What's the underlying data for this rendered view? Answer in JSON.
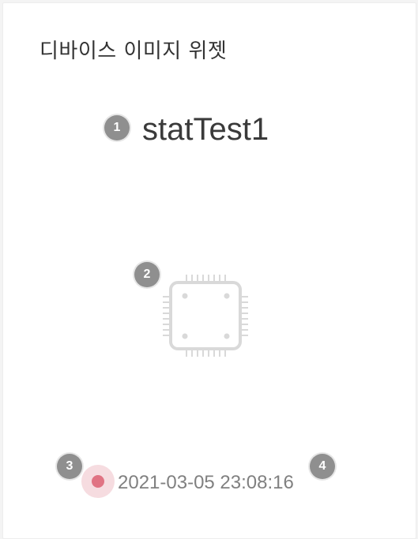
{
  "widget": {
    "title": "디바이스 이미지 위젯",
    "device_name": "statTest1",
    "device_image_icon": "chip-icon",
    "status": {
      "state": "offline",
      "color": "#e07383"
    },
    "timestamp": "2021-03-05 23:08:16"
  },
  "markers": [
    "1",
    "2",
    "3",
    "4"
  ]
}
